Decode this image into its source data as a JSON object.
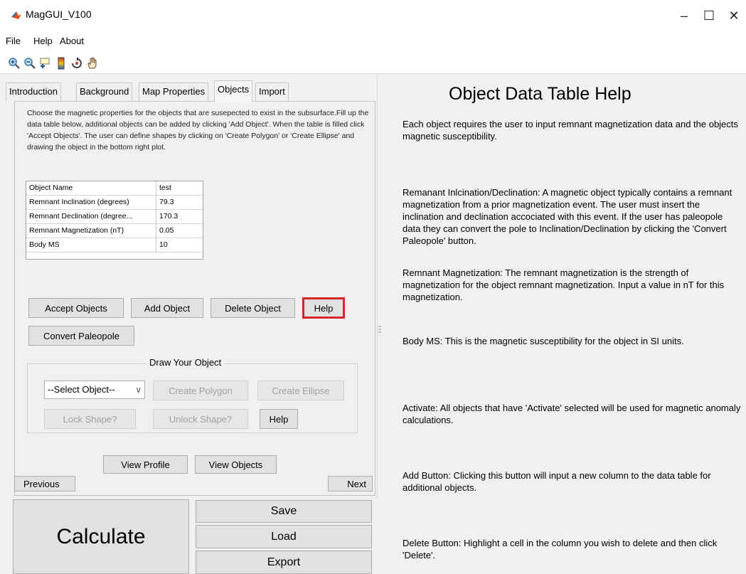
{
  "window": {
    "title": "MagGUI_V100",
    "controls": [
      "–",
      "☐",
      "✕"
    ]
  },
  "menu": [
    "File",
    "Help",
    "About"
  ],
  "toolbar": [
    "zoom-in-icon",
    "zoom-out-icon",
    "data-tip-icon",
    "colorbar-icon",
    "rotate-icon",
    "pan-icon"
  ],
  "tabs": [
    {
      "label": "Introduction",
      "active": false
    },
    {
      "label": "Background",
      "active": false
    },
    {
      "label": "Map Properties",
      "active": false
    },
    {
      "label": "Objects",
      "active": true
    },
    {
      "label": "Import",
      "active": false
    }
  ],
  "objects_tab": {
    "instructions": "Choose the magnetic properties for the objects that are susepected to exist in the subsurface.Fill up the data table below, additional objects can be added by clicking 'Add Object'. When the table is filled click 'Accept Objects'. The user can define shapes by clicking on 'Create Polygon' or 'Create Ellipse' and drawing the object in the bottom right plot.",
    "table": {
      "rows": [
        {
          "label": "Object Name",
          "value": "test"
        },
        {
          "label": "Remnant Inclination (degrees)",
          "value": "79.3"
        },
        {
          "label": "Remnant Declination (degree...",
          "value": "170.3"
        },
        {
          "label": "Remnant Magnetization (nT)",
          "value": "0.05"
        },
        {
          "label": "Body MS",
          "value": "10"
        }
      ]
    },
    "buttons": {
      "accept": "Accept Objects",
      "add": "Add Object",
      "delete": "Delete Object",
      "help": "Help",
      "convert": "Convert Paleopole"
    },
    "draw": {
      "title": "Draw Your Object",
      "select_value": "--Select Object--",
      "create_polygon": "Create Polygon",
      "create_ellipse": "Create Ellipse",
      "lock": "Lock Shape?",
      "unlock": "Unlock Shape?",
      "help": "Help"
    },
    "view_profile": "View Profile",
    "view_objects": "View Objects",
    "previous": "Previous",
    "next": "Next"
  },
  "bottom": {
    "calculate": "Calculate",
    "save": "Save",
    "load": "Load",
    "export": "Export"
  },
  "help_panel": {
    "title": "Object Data Table Help",
    "paragraphs": [
      "Each object requires the user to input remnant magnetization data and the objects magnetic susceptibility.",
      "Remanant Inlcination/Declination: A magnetic object typically contains a remnant magnetization from a prior magnetization event. The user must insert the inclination and declination accociated with this event. If the user has paleopole data they can convert the pole to Inclination/Declination by clicking the 'Convert Paleopole' button.",
      "Remnant Magnetization: The remnant magnetization is the strength of magnetization for the object remnant magnetization. Input a value in nT for this magnetization.",
      "Body MS: This is the magnetic susceptibility for the object in SI units.",
      "Activate: All objects that have 'Activate' selected will be used for magnetic anomaly calculations.",
      "Add Button: Clicking this button will input a new column to the data table for additional objects.",
      "Delete Button: Highlight a cell in the column you wish to delete and then click 'Delete'."
    ]
  },
  "colors": {
    "help_highlight": "#d9232d",
    "background": "#f0f0f0",
    "button": "#e1e1e1"
  }
}
